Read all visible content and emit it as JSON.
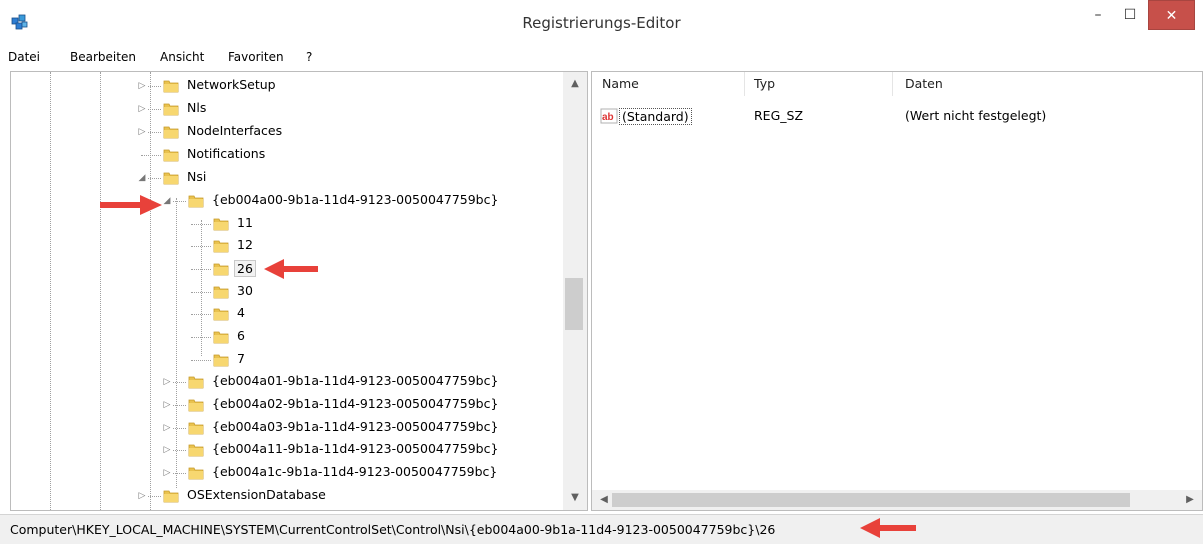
{
  "window": {
    "title": "Registrierungs-Editor",
    "icon": "regedit-icon",
    "minimize": "–",
    "maximize": "☐",
    "close": "✕"
  },
  "menu": [
    "Datei",
    "Bearbeiten",
    "Ansicht",
    "Favoriten",
    "?"
  ],
  "tree": {
    "nodes": [
      {
        "label": "NetworkSetup"
      },
      {
        "label": "Nls"
      },
      {
        "label": "NodeInterfaces"
      },
      {
        "label": "Notifications"
      },
      {
        "label": "Nsi"
      },
      {
        "label": "{eb004a00-9b1a-11d4-9123-0050047759bc}"
      },
      {
        "label": "11"
      },
      {
        "label": "12"
      },
      {
        "label": "26"
      },
      {
        "label": "30"
      },
      {
        "label": "4"
      },
      {
        "label": "6"
      },
      {
        "label": "7"
      },
      {
        "label": "{eb004a01-9b1a-11d4-9123-0050047759bc}"
      },
      {
        "label": "{eb004a02-9b1a-11d4-9123-0050047759bc}"
      },
      {
        "label": "{eb004a03-9b1a-11d4-9123-0050047759bc}"
      },
      {
        "label": "{eb004a11-9b1a-11d4-9123-0050047759bc}"
      },
      {
        "label": "{eb004a1c-9b1a-11d4-9123-0050047759bc}"
      },
      {
        "label": "OSExtensionDatabase"
      }
    ]
  },
  "list": {
    "columns": [
      "Name",
      "Typ",
      "Daten"
    ],
    "rows": [
      {
        "icon": "string-value-icon",
        "name": "(Standard)",
        "type": "REG_SZ",
        "data": "(Wert nicht festgelegt)"
      }
    ]
  },
  "status": {
    "path": "Computer\\HKEY_LOCAL_MACHINE\\SYSTEM\\CurrentControlSet\\Control\\Nsi\\{eb004a00-9b1a-11d4-9123-0050047759bc}\\26"
  },
  "colors": {
    "close_button": "#c7504a",
    "annotation_arrow": "#e8413a",
    "folder": "#e9c24f"
  }
}
